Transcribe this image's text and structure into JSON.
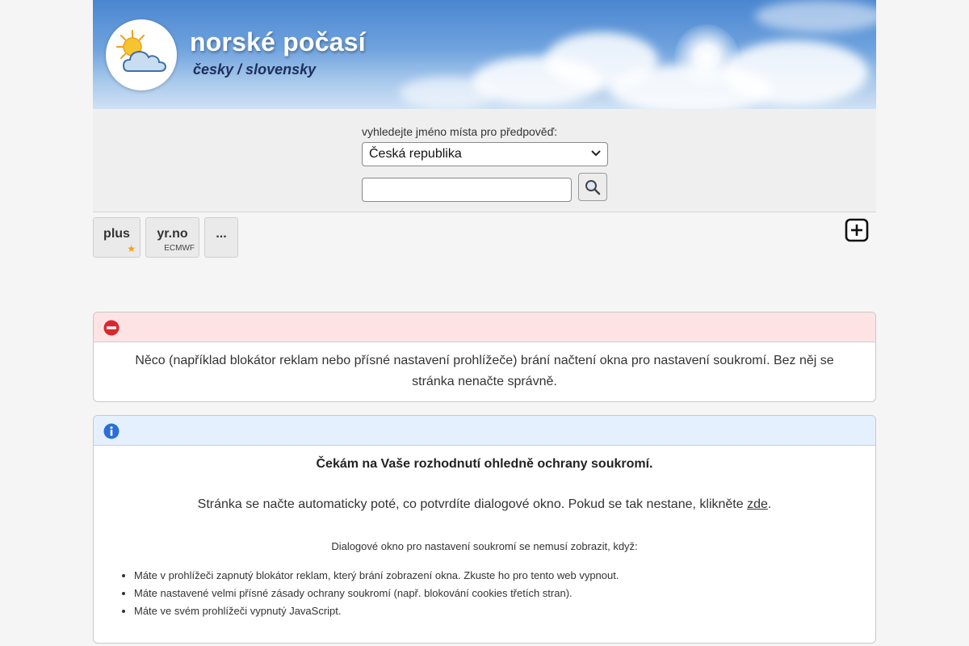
{
  "header": {
    "title": "norské počasí",
    "subtitle": "česky / slovensky"
  },
  "search": {
    "label": "vyhledejte jméno místa pro předpověď:",
    "country_selected": "Česká republika",
    "place_value": "",
    "button_icon": "search-icon"
  },
  "tabs": [
    {
      "title": "plus",
      "note_icon": "star-icon"
    },
    {
      "title": "yr.no",
      "note": "ECMWF"
    },
    {
      "title": "..."
    }
  ],
  "toolbar": {
    "add_icon": "plus-square-icon"
  },
  "error_box": {
    "icon": "no-entry-icon",
    "message": "Něco (například blokátor reklam nebo přísné nastavení prohlížeče) brání načtení okna pro nastavení soukromí. Bez něj se stránka nenačte správně."
  },
  "info_box": {
    "icon": "info-icon",
    "heading": "Čekám na Vaše rozhodnutí ohledně ochrany soukromí.",
    "line_before_link": "Stránka se načte automaticky poté, co potvrdíte dialogové okno. Pokud se tak nestane, klikněte ",
    "link": "zde",
    "line_after_link": ".",
    "small": "Dialogové okno pro nastavení soukromí se nemusí zobrazit, když:",
    "reasons": [
      "Máte v prohlížeči zapnutý blokátor reklam, který brání zobrazení okna. Zkuste ho pro tento web vypnout.",
      "Máte nastavené velmi přísné zásady ochrany soukromí (např. blokování cookies třetích stran).",
      "Máte ve svém prohlížeči vypnutý JavaScript."
    ]
  },
  "colors": {
    "error_bg": "#fde3e4",
    "error_icon": "#d9272e",
    "info_bg": "#e4f0fe",
    "info_icon": "#2b6fd6",
    "star": "#f0a020"
  }
}
